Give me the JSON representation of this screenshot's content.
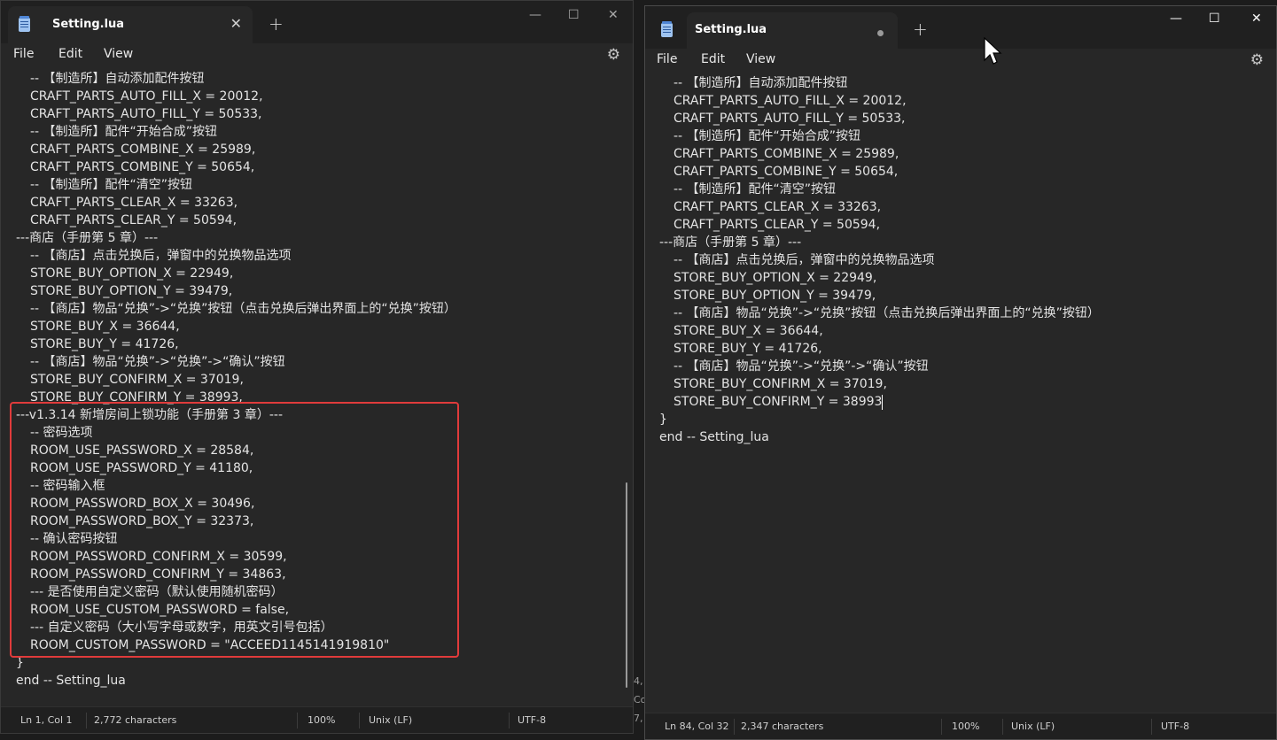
{
  "left_window": {
    "tab_title": "Setting.lua",
    "tab_close": "✕",
    "newtab": "+",
    "controls": {
      "minimize": "—",
      "maximize": "☐",
      "close": "✕"
    },
    "menu": {
      "file": "File",
      "edit": "Edit",
      "view": "View"
    },
    "lines": [
      {
        "t": "-- 【制造所】自动添加配件按钮",
        "i": true
      },
      {
        "t": "CRAFT_PARTS_AUTO_FILL_X = 20012,",
        "i": true
      },
      {
        "t": "CRAFT_PARTS_AUTO_FILL_Y = 50533,",
        "i": true
      },
      {
        "t": "-- 【制造所】配件“开始合成”按钮",
        "i": true
      },
      {
        "t": "CRAFT_PARTS_COMBINE_X = 25989,",
        "i": true
      },
      {
        "t": "CRAFT_PARTS_COMBINE_Y = 50654,",
        "i": true
      },
      {
        "t": "-- 【制造所】配件“清空”按钮",
        "i": true
      },
      {
        "t": "CRAFT_PARTS_CLEAR_X = 33263,",
        "i": true
      },
      {
        "t": "CRAFT_PARTS_CLEAR_Y = 50594,",
        "i": true
      },
      {
        "t": "---商店（手册第 5 章）---",
        "i": false
      },
      {
        "t": "-- 【商店】点击兑换后，弹窗中的兑换物品选项",
        "i": true
      },
      {
        "t": "STORE_BUY_OPTION_X = 22949,",
        "i": true
      },
      {
        "t": "STORE_BUY_OPTION_Y = 39479,",
        "i": true
      },
      {
        "t": "-- 【商店】物品“兑换”->“兑换”按钮（点击兑换后弹出界面上的“兑换”按钮）",
        "i": true
      },
      {
        "t": "STORE_BUY_X = 36644,",
        "i": true
      },
      {
        "t": "STORE_BUY_Y = 41726,",
        "i": true
      },
      {
        "t": "-- 【商店】物品“兑换”->“兑换”->“确认”按钮",
        "i": true
      },
      {
        "t": "STORE_BUY_CONFIRM_X = 37019,",
        "i": true
      },
      {
        "t": "STORE_BUY_CONFIRM_Y = 38993,",
        "i": true
      },
      {
        "t": "---v1.3.14 新增房间上锁功能（手册第 3 章）---",
        "i": false
      },
      {
        "t": "-- 密码选项",
        "i": true
      },
      {
        "t": "ROOM_USE_PASSWORD_X = 28584,",
        "i": true
      },
      {
        "t": "ROOM_USE_PASSWORD_Y = 41180,",
        "i": true
      },
      {
        "t": "-- 密码输入框",
        "i": true
      },
      {
        "t": "ROOM_PASSWORD_BOX_X = 30496,",
        "i": true
      },
      {
        "t": "ROOM_PASSWORD_BOX_Y = 32373,",
        "i": true
      },
      {
        "t": "-- 确认密码按钮",
        "i": true
      },
      {
        "t": "ROOM_PASSWORD_CONFIRM_X = 30599,",
        "i": true
      },
      {
        "t": "ROOM_PASSWORD_CONFIRM_Y = 34863,",
        "i": true
      },
      {
        "t": "--- 是否使用自定义密码（默认使用随机密码）",
        "i": true
      },
      {
        "t": "ROOM_USE_CUSTOM_PASSWORD = false,",
        "i": true
      },
      {
        "t": "--- 自定义密码（大小写字母或数字，用英文引号包括）",
        "i": true
      },
      {
        "t": "ROOM_CUSTOM_PASSWORD = \"ACCEED1145141919810\"",
        "i": true
      },
      {
        "t": "}",
        "i": false
      },
      {
        "t": "end -- Setting_lua",
        "i": false
      }
    ],
    "status": {
      "position": "Ln 1, Col 1",
      "chars": "2,772 characters",
      "zoom": "100%",
      "eol": "Unix (LF)",
      "encoding": "UTF-8"
    }
  },
  "right_window": {
    "tab_title": "Setting.lua",
    "newtab": "+",
    "controls": {
      "minimize": "—",
      "maximize": "☐",
      "close": "✕"
    },
    "menu": {
      "file": "File",
      "edit": "Edit",
      "view": "View"
    },
    "lines": [
      {
        "t": "-- 【制造所】自动添加配件按钮",
        "i": true
      },
      {
        "t": "CRAFT_PARTS_AUTO_FILL_X = 20012,",
        "i": true
      },
      {
        "t": "CRAFT_PARTS_AUTO_FILL_Y = 50533,",
        "i": true
      },
      {
        "t": "-- 【制造所】配件“开始合成”按钮",
        "i": true
      },
      {
        "t": "CRAFT_PARTS_COMBINE_X = 25989,",
        "i": true
      },
      {
        "t": "CRAFT_PARTS_COMBINE_Y = 50654,",
        "i": true
      },
      {
        "t": "-- 【制造所】配件“清空”按钮",
        "i": true
      },
      {
        "t": "CRAFT_PARTS_CLEAR_X = 33263,",
        "i": true
      },
      {
        "t": "CRAFT_PARTS_CLEAR_Y = 50594,",
        "i": true
      },
      {
        "t": "---商店（手册第 5 章）---",
        "i": false
      },
      {
        "t": "-- 【商店】点击兑换后，弹窗中的兑换物品选项",
        "i": true
      },
      {
        "t": "STORE_BUY_OPTION_X = 22949,",
        "i": true
      },
      {
        "t": "STORE_BUY_OPTION_Y = 39479,",
        "i": true
      },
      {
        "t": "-- 【商店】物品“兑换”->“兑换”按钮（点击兑换后弹出界面上的“兑换”按钮）",
        "i": true
      },
      {
        "t": "STORE_BUY_X = 36644,",
        "i": true
      },
      {
        "t": "STORE_BUY_Y = 41726,",
        "i": true
      },
      {
        "t": "-- 【商店】物品“兑换”->“兑换”->“确认”按钮",
        "i": true
      },
      {
        "t": "STORE_BUY_CONFIRM_X = 37019,",
        "i": true
      },
      {
        "t": "STORE_BUY_CONFIRM_Y = 38993",
        "i": true
      },
      {
        "t": "}",
        "i": false
      },
      {
        "t": "end -- Setting_lua",
        "i": false
      }
    ],
    "status": {
      "position": "Ln 84, Col 32",
      "chars": "2,347 characters",
      "zoom": "100%",
      "eol": "Unix (LF)",
      "encoding": "UTF-8"
    }
  },
  "background_fragments": [
    "4,",
    "Co",
    "7,"
  ]
}
